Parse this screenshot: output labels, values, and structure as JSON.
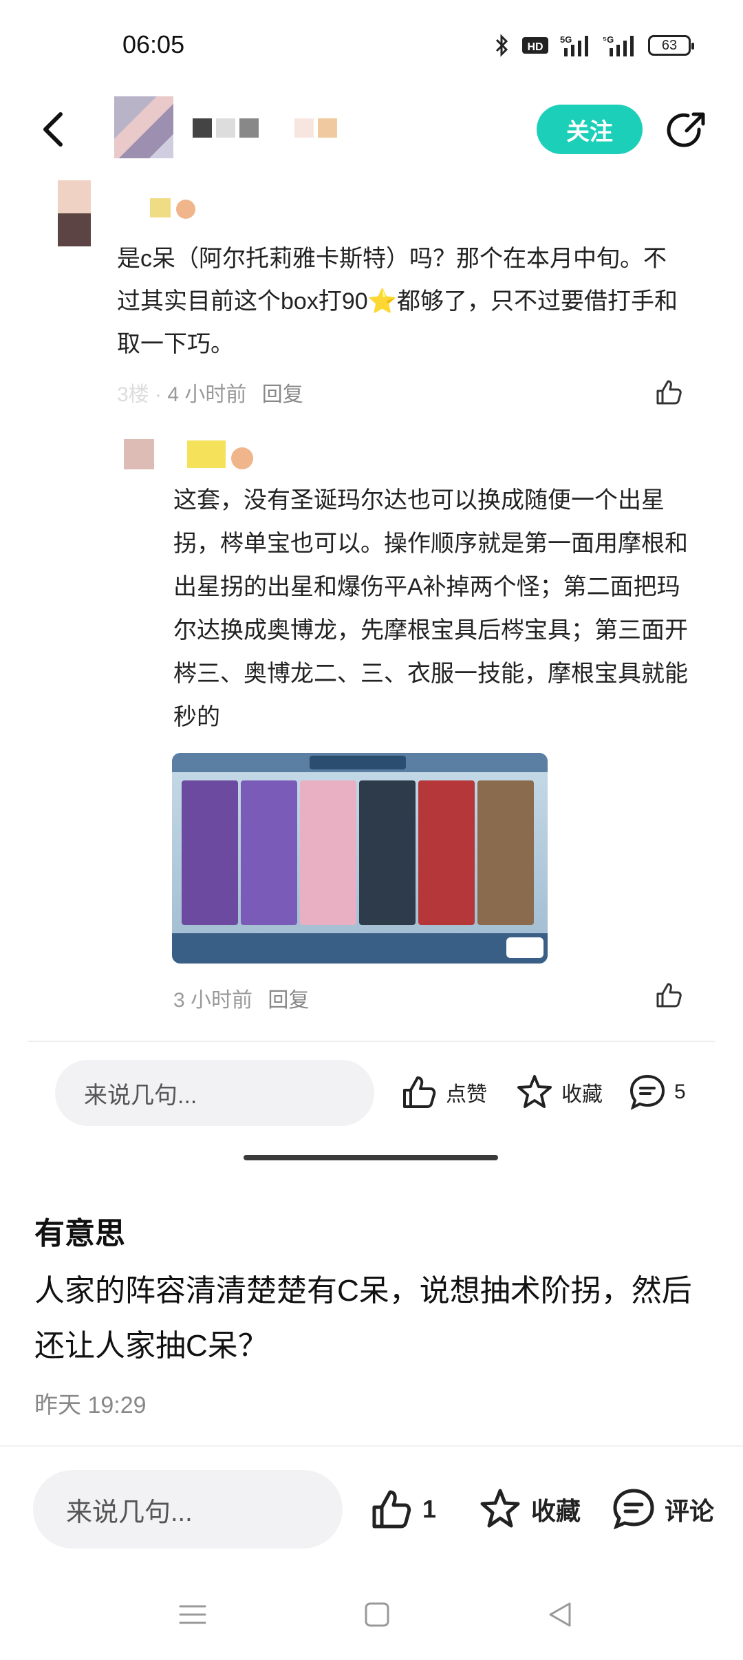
{
  "status": {
    "time": "06:05",
    "battery": "63"
  },
  "header": {
    "follow_label": "关注"
  },
  "comment1": {
    "text": "是c呆（阿尔托莉雅卡斯特）吗？那个在本月中旬。不过其实目前这个box打90⭐都够了，只不过要借打手和取一下巧。",
    "meta_floor": "3楼",
    "meta_time": "4 小时前",
    "reply_label": "回复"
  },
  "reply": {
    "text": "这套，没有圣诞玛尔达也可以换成随便一个出星拐，梣单宝也可以。操作顺序就是第一面用摩根和出星拐的出星和爆伤平A补掉两个怪；第二面把玛尔达换成奥博龙，先摩根宝具后梣宝具；第三面开梣三、奥博龙二、三、衣服一技能，摩根宝具就能秒的",
    "meta_time": "3 小时前",
    "reply_label": "回复"
  },
  "action_bar": {
    "input_placeholder": "来说几句...",
    "like_label": "点赞",
    "fav_label": "收藏",
    "comment_count": "5"
  },
  "post": {
    "title": "有意思",
    "body": "人家的阵容清清楚楚有C呆，说想抽术阶拐，然后还让人家抽C呆？",
    "date": "昨天 19:29"
  },
  "bottom_bar": {
    "input_placeholder": "来说几句...",
    "like_count": "1",
    "fav_label": "收藏",
    "comment_label": "评论"
  },
  "colors": {
    "accent": "#1ccfb9"
  }
}
